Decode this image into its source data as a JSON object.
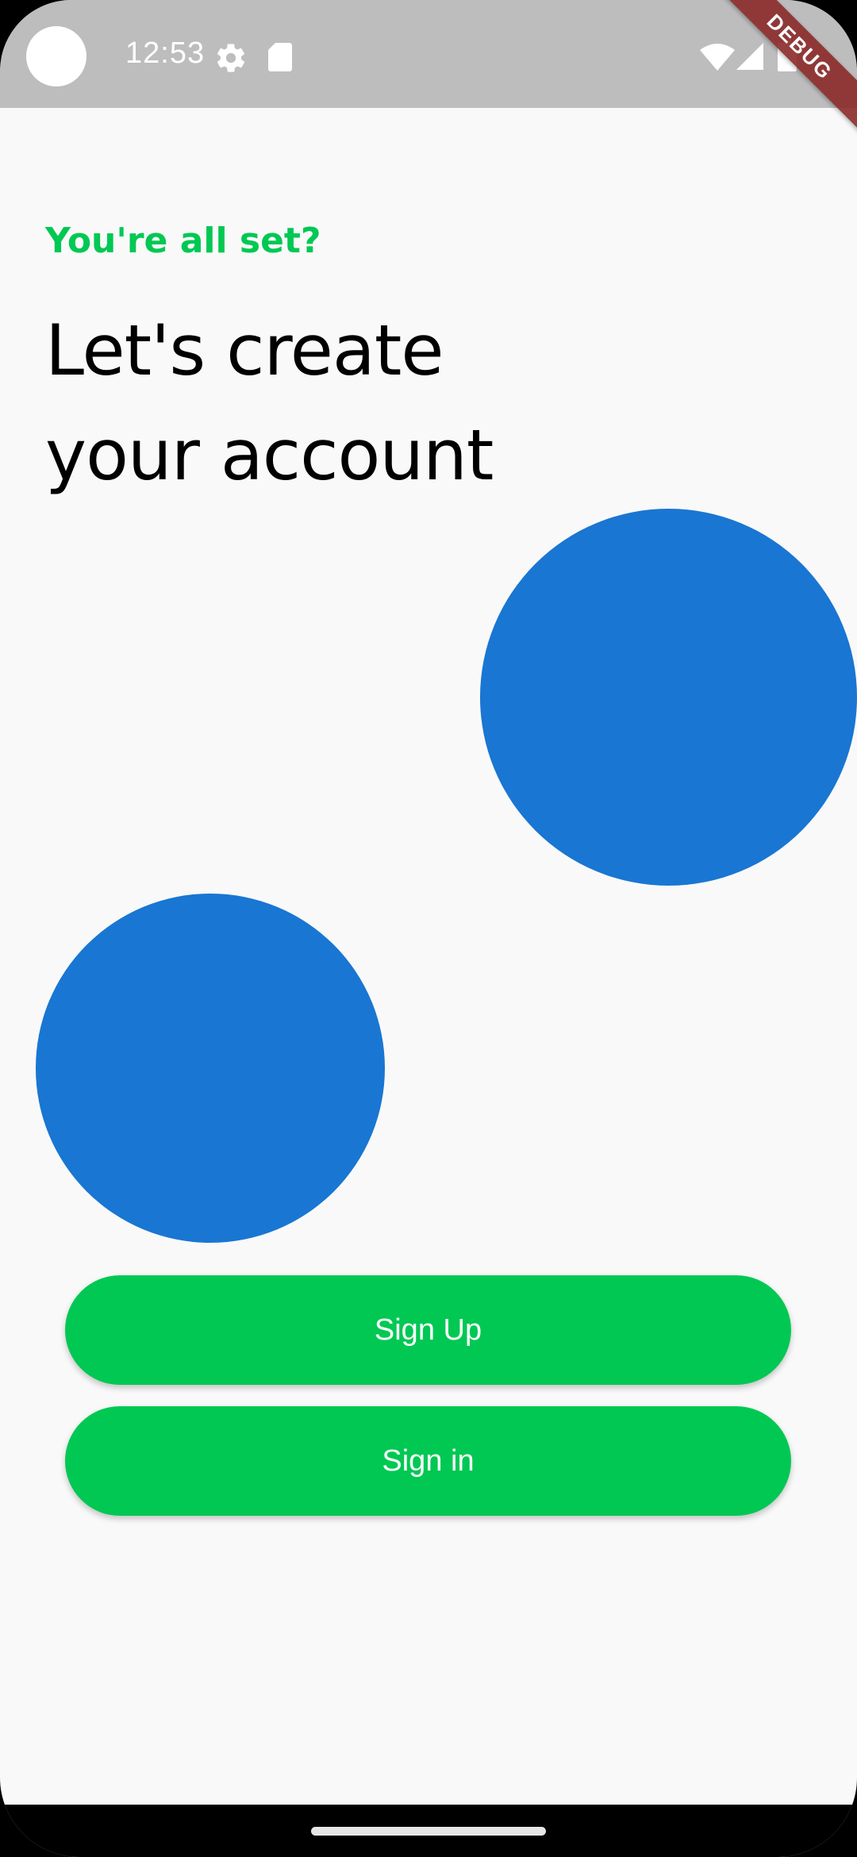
{
  "status_bar": {
    "time": "12:53",
    "icons": [
      "gear-icon",
      "sd-card-icon",
      "wifi-icon",
      "signal-icon",
      "battery-icon"
    ],
    "background": "#bdbdbd"
  },
  "debug_banner": {
    "label": "DEBUG",
    "color": "#8b2a2a"
  },
  "onboarding": {
    "subtitle": "You're all set?",
    "headline_line1": "Let's create",
    "headline_line2": "your account"
  },
  "actions": {
    "sign_up_label": "Sign Up",
    "sign_in_label": "Sign in"
  },
  "colors": {
    "accent_green": "#00c853",
    "circle_blue": "#1976d2",
    "background": "#f9f9f9"
  }
}
